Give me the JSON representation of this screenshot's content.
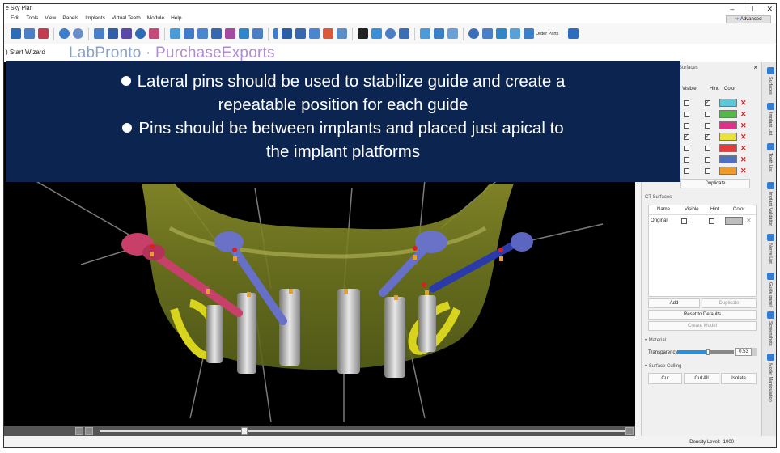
{
  "window": {
    "title": "e Sky Plan",
    "minimize": "–",
    "maximize": "☐",
    "close": "✕"
  },
  "menu": [
    "Edit",
    "Tools",
    "View",
    "Panels",
    "Implants",
    "Virtual Teeth",
    "Module",
    "Help"
  ],
  "toolbar": {
    "advanced_label": "Advanced",
    "order_parts_label": "Order Parts"
  },
  "toolbar2": {
    "wizard_label": ") Start Wizard",
    "brand_lab": "LabPronto",
    "brand_sep": "·",
    "brand_purchase": "PurchaseExports"
  },
  "overlay": {
    "lines": [
      "Lateral pins should be used to stabilize guide and create a",
      "repeatable position for each guide",
      "Pins should be between implants and placed just apical to",
      "the implant platforms"
    ]
  },
  "surfaces_panel": {
    "title": "Surfaces",
    "columns": [
      "Visible",
      "Hint",
      "Color"
    ],
    "rows": [
      {
        "visible": false,
        "hint": true,
        "color": "#5ac8d8"
      },
      {
        "visible": false,
        "hint": false,
        "color": "#53b848"
      },
      {
        "visible": false,
        "hint": false,
        "color": "#e0308a"
      },
      {
        "visible": true,
        "hint": true,
        "color": "#e8e23a"
      },
      {
        "visible": false,
        "hint": false,
        "color": "#e23c3c"
      },
      {
        "visible": false,
        "hint": false,
        "color": "#4f6fc0"
      },
      {
        "visible": false,
        "hint": false,
        "color": "#f09a2a"
      }
    ],
    "duplicate_label": "Duplicate"
  },
  "ct_surfaces": {
    "title": "CT Surfaces",
    "columns": [
      "Name",
      "Visible",
      "Hint",
      "Color"
    ],
    "rows": [
      {
        "name": "Original",
        "visible": false,
        "hint": false,
        "color": "#bdbdbd"
      }
    ],
    "add_label": "Add",
    "duplicate_label": "Duplicate",
    "reset_label": "Reset to Defaults",
    "create_model_label": "Create Model"
  },
  "material": {
    "title": "Material",
    "transparency_label": "Transparency",
    "transparency_value": "0.53"
  },
  "surface_culling": {
    "title": "Surface Culling",
    "cut_label": "Cut",
    "cut_all_label": "Cut All",
    "isolate_label": "Isolate"
  },
  "side_tabs": [
    "Surfaces",
    "Implant List",
    "Tooth List",
    "Implant Validation",
    "Nerve List",
    "Guide panel",
    "Screenshots",
    "Model Manipulation"
  ],
  "status": {
    "density_label": "Density Level: -1000"
  },
  "colors": {
    "overlay_bg": "#0b2450",
    "accent": "#2f7ed3",
    "delete": "#d21f1f"
  }
}
